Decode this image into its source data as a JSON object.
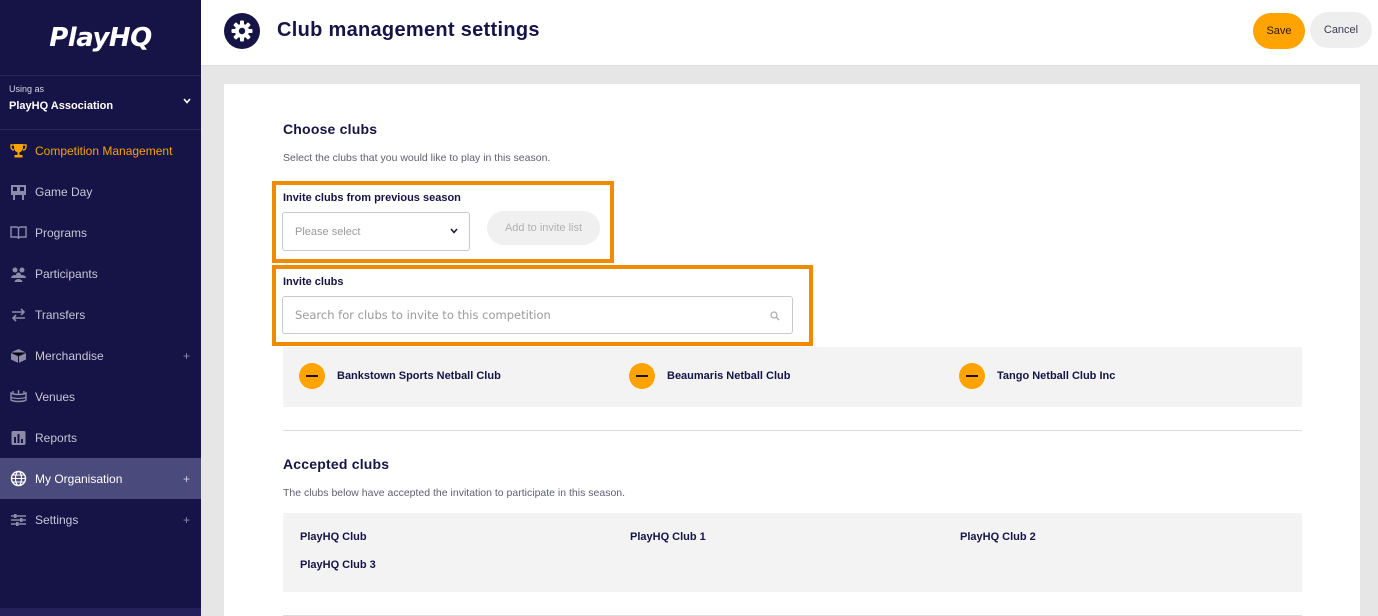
{
  "sidebar": {
    "logo_text": "PlayHQ",
    "using_as_label": "Using as",
    "org_name": "PlayHQ Association",
    "items": [
      {
        "label": "Competition Management",
        "icon": "trophy-icon"
      },
      {
        "label": "Game Day",
        "icon": "scoreboard-icon"
      },
      {
        "label": "Programs",
        "icon": "book-icon"
      },
      {
        "label": "Participants",
        "icon": "people-icon"
      },
      {
        "label": "Transfers",
        "icon": "transfer-arrows-icon"
      },
      {
        "label": "Merchandise",
        "icon": "box-icon"
      },
      {
        "label": "Venues",
        "icon": "stadium-icon"
      },
      {
        "label": "Reports",
        "icon": "report-icon"
      },
      {
        "label": "My Organisation",
        "icon": "globe-icon"
      },
      {
        "label": "Settings",
        "icon": "sliders-icon"
      }
    ],
    "expand_symbol": "+"
  },
  "header": {
    "title": "Club management settings",
    "save_label": "Save",
    "cancel_label": "Cancel"
  },
  "choose": {
    "heading": "Choose clubs",
    "description": "Select the clubs that you would like to play in this season.",
    "previous_label": "Invite clubs from previous season",
    "select_placeholder": "Please select",
    "add_button": "Add to invite list",
    "invite_label": "Invite clubs",
    "search_placeholder": "Search for clubs to invite to this competition",
    "invited": [
      "Bankstown Sports Netball Club",
      "Beaumaris Netball Club",
      "Tango Netball Club Inc"
    ]
  },
  "accepted": {
    "heading": "Accepted clubs",
    "description": "The clubs below have accepted the invitation to participate in this season.",
    "clubs": [
      "PlayHQ Club",
      "PlayHQ Club 1",
      "PlayHQ Club 2",
      "PlayHQ Club 3"
    ]
  },
  "colors": {
    "sidebar_bg": "#161346",
    "accent": "#ffa300",
    "highlight": "#f08a00"
  }
}
